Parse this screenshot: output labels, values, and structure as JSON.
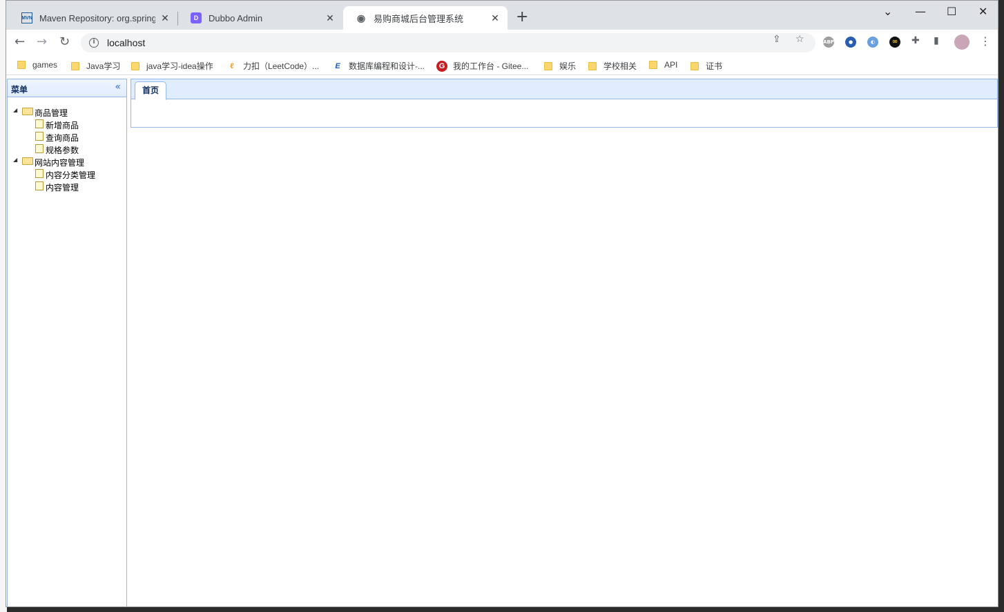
{
  "browser": {
    "tabs": [
      {
        "title": "Maven Repository: org.springf",
        "favicon": "mvn-icon",
        "active": false
      },
      {
        "title": "Dubbo Admin",
        "favicon": "dubbo-icon",
        "active": false
      },
      {
        "title": "易购商城后台管理系统",
        "favicon": "globe-icon",
        "active": true
      }
    ],
    "address": "localhost",
    "bookmarks": [
      {
        "label": "games",
        "icon": "folder-icon"
      },
      {
        "label": "Java学习",
        "icon": "folder-icon"
      },
      {
        "label": "java学习-idea操作",
        "icon": "folder-icon"
      },
      {
        "label": "力扣（LeetCode）...",
        "icon": "leetcode-icon"
      },
      {
        "label": "数据库编程和设计-...",
        "icon": "db-icon"
      },
      {
        "label": "我的工作台 - Gitee...",
        "icon": "gitee-icon"
      },
      {
        "label": "娱乐",
        "icon": "folder-icon"
      },
      {
        "label": "学校相关",
        "icon": "folder-icon"
      },
      {
        "label": "API",
        "icon": "folder-icon"
      },
      {
        "label": "证书",
        "icon": "folder-icon"
      }
    ]
  },
  "menu": {
    "title": "菜单",
    "groups": [
      {
        "label": "商品管理",
        "items": [
          "新增商品",
          "查询商品",
          "规格参数"
        ]
      },
      {
        "label": "网站内容管理",
        "items": [
          "内容分类管理",
          "内容管理"
        ]
      }
    ]
  },
  "content": {
    "tabs": [
      "首页"
    ]
  },
  "colors": {
    "panel_border": "#95b8e7",
    "panel_header": "#e0ecff",
    "title_text": "#0e2d5f"
  }
}
